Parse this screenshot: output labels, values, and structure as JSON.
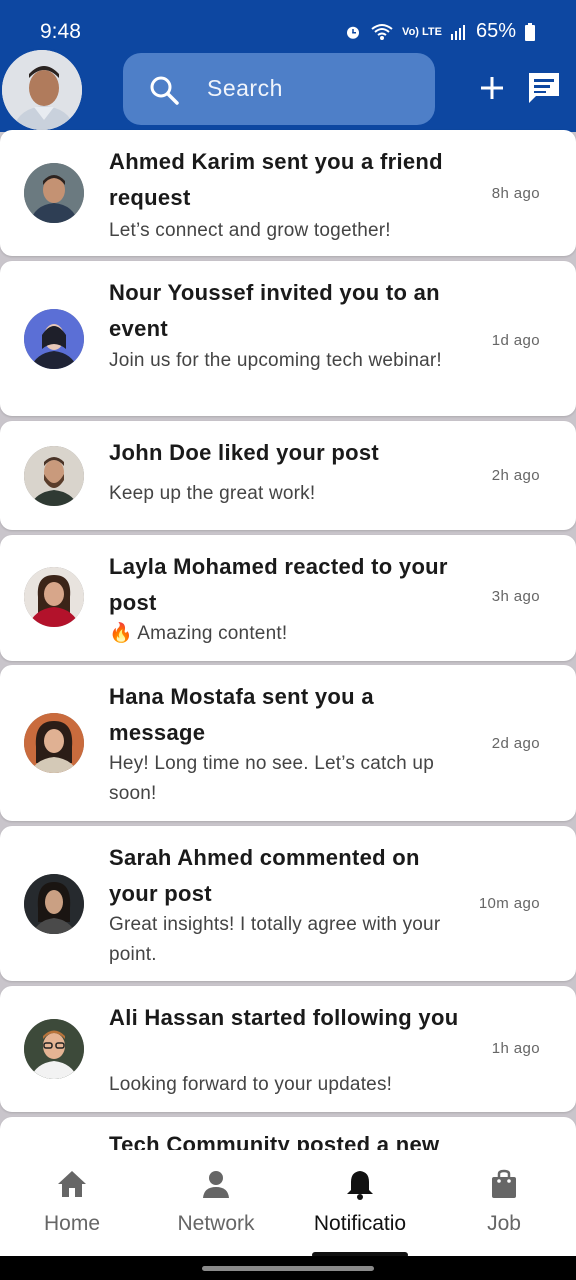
{
  "status_bar": {
    "time": "9:48",
    "battery": "65%",
    "lte": "Vo) LTE",
    "icons": [
      "alarm-icon",
      "wifi-icon",
      "signal-icon",
      "battery-icon"
    ]
  },
  "header": {
    "search_placeholder": "Search",
    "icons": [
      "search-icon",
      "plus-icon",
      "message-icon"
    ]
  },
  "notifications": [
    {
      "title": "Ahmed Karim sent you a friend request",
      "message": "Let’s connect and grow together!",
      "time": "8h ago"
    },
    {
      "title": "Nour Youssef invited you to an event",
      "message": "Join us for the upcoming tech webinar!",
      "time": "1d ago"
    },
    {
      "title": "John Doe liked your post",
      "message": "Keep up the great work!",
      "time": "2h ago"
    },
    {
      "title": "Layla Mohamed reacted to your post",
      "message": "🔥 Amazing content!",
      "time": "3h ago"
    },
    {
      "title": "Hana Mostafa sent you a message",
      "message": "Hey! Long time no see. Let’s catch up soon!",
      "time": "2d ago"
    },
    {
      "title": "Sarah Ahmed commented on your post",
      "message": "Great insights! I totally agree with your point.",
      "time": "10m ago"
    },
    {
      "title": "Ali Hassan started following you",
      "message": "Looking forward to your updates!",
      "time": "1h ago"
    },
    {
      "title": "Tech Community posted a new",
      "message": "",
      "time": ""
    }
  ],
  "bottom_nav": [
    {
      "label": "Home",
      "icon": "home-icon",
      "active": false
    },
    {
      "label": "Network",
      "icon": "person-icon",
      "active": false
    },
    {
      "label": "Notificatio",
      "icon": "bell-icon",
      "active": true
    },
    {
      "label": "Job",
      "icon": "bag-icon",
      "active": false
    }
  ],
  "colors": {
    "header": "#0d47a1",
    "search": "#4e7fc8",
    "background": "#c9c5cb"
  }
}
